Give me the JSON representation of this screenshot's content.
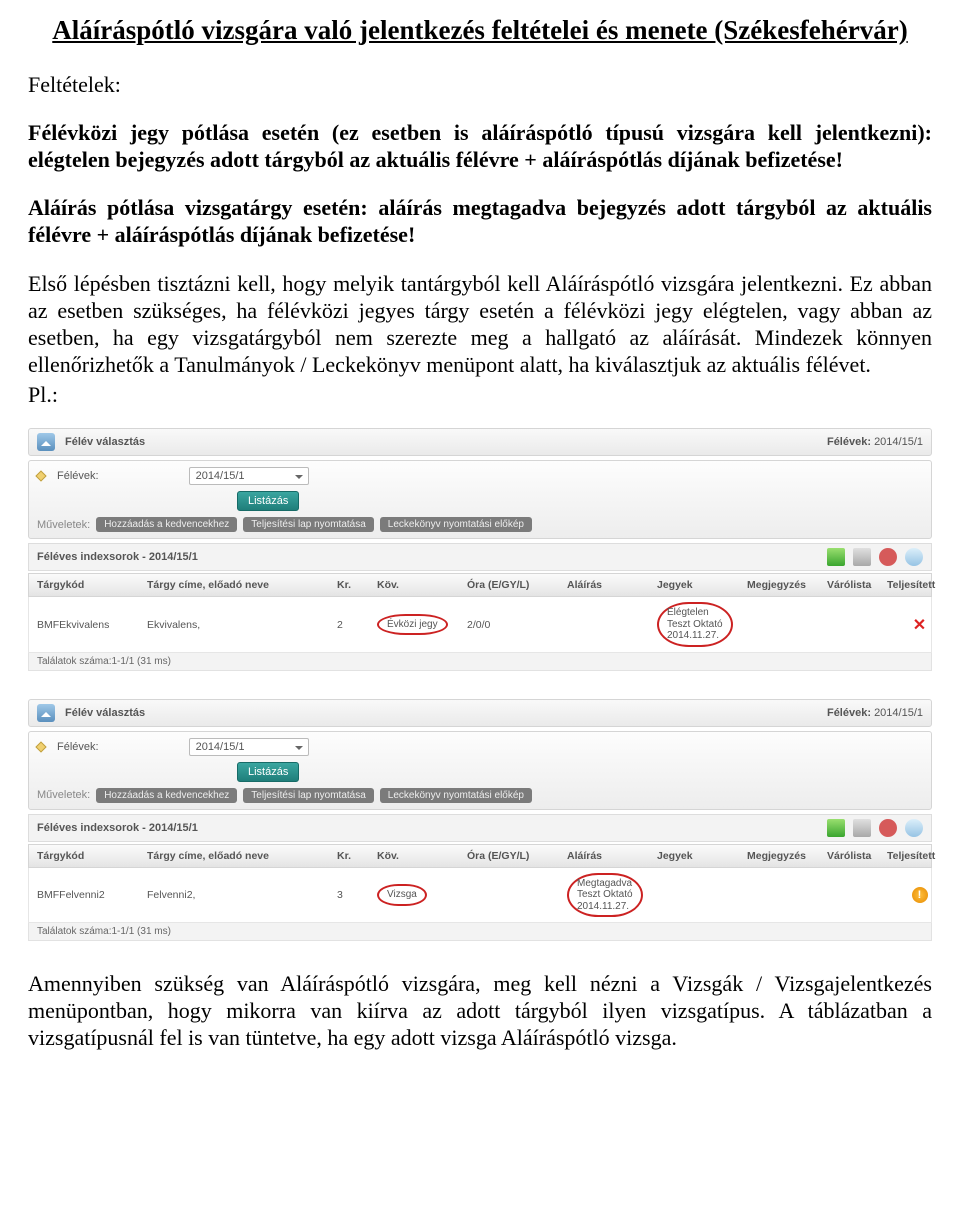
{
  "title": "Aláíráspótló vizsgára való jelentkezés feltételei és menete (Székesfehérvár)",
  "subheading": "Feltételek:",
  "bold1": "Félévközi jegy pótlása esetén (ez esetben is aláíráspótló típusú vizsgára kell jelentkezni): elégtelen bejegyzés adott tárgyból az aktuális félévre + aláíráspótlás díjának befizetése!",
  "bold2": "Aláírás pótlása vizsgatárgy esetén: aláírás megtagadva bejegyzés adott tárgyból az aktuális félévre + aláíráspótlás díjának befizetése!",
  "para": "Első lépésben tisztázni kell, hogy melyik tantárgyból kell Aláíráspótló vizsgára jelentkezni. Ez abban az esetben szükséges, ha félévközi jegyes tárgy esetén a félévközi jegy elégtelen, vagy abban az esetben, ha egy vizsgatárgyból nem szerezte meg a hallgató az aláírását. Mindezek könnyen ellenőrizhetők a Tanulmányok / Leckekönyv menüpont alatt, ha kiválasztjuk az aktuális félévet.",
  "pl": "Pl.:",
  "ui": {
    "panel_title": "Félév választás",
    "panel_right_label": "Félévek: ",
    "semester": "2014/15/1",
    "felevek_label": "Félévek:",
    "list_btn": "Listázás",
    "ops_label": "Műveletek:",
    "op_fav": "Hozzáadás a kedvencekhez",
    "op_print": "Teljesítési lap nyomtatása",
    "op_book": "Leckekönyv nyomtatási előkép",
    "section": "Féléves indexsorok - 2014/15/1",
    "headers": {
      "c1": "Tárgykód",
      "c2": "Tárgy címe, előadó neve",
      "c3": "Kr.",
      "c4": "Köv.",
      "c5": "Óra (E/GY/L)",
      "c6": "Aláírás",
      "c7": "Jegyek",
      "c8": "Megjegyzés",
      "c9": "Várólista",
      "c10": "Teljesített"
    },
    "row1": {
      "code": "BMFEkvivalens",
      "title": "Ekvivalens,",
      "kr": "2",
      "kov": "Évközi jegy",
      "ora": "2/0/0",
      "jegyek": "Elégtelen\nTeszt Oktató\n2014.11.27."
    },
    "row2": {
      "code": "BMFFelvenni2",
      "title": "Felvenni2,",
      "kr": "3",
      "kov": "Vizsga",
      "ora": "",
      "alairas": "Megtagadva\nTeszt Oktató\n2014.11.27."
    },
    "footer": "Találatok száma:1-1/1 (31 ms)"
  },
  "closing": "Amennyiben szükség van Aláíráspótló vizsgára, meg kell nézni a Vizsgák / Vizsgajelentkezés menüpontban, hogy mikorra van kiírva az adott tárgyból ilyen vizsgatípus. A táblázatban a vizsgatípusnál fel is van tüntetve, ha egy adott vizsga Aláíráspótló vizsga."
}
